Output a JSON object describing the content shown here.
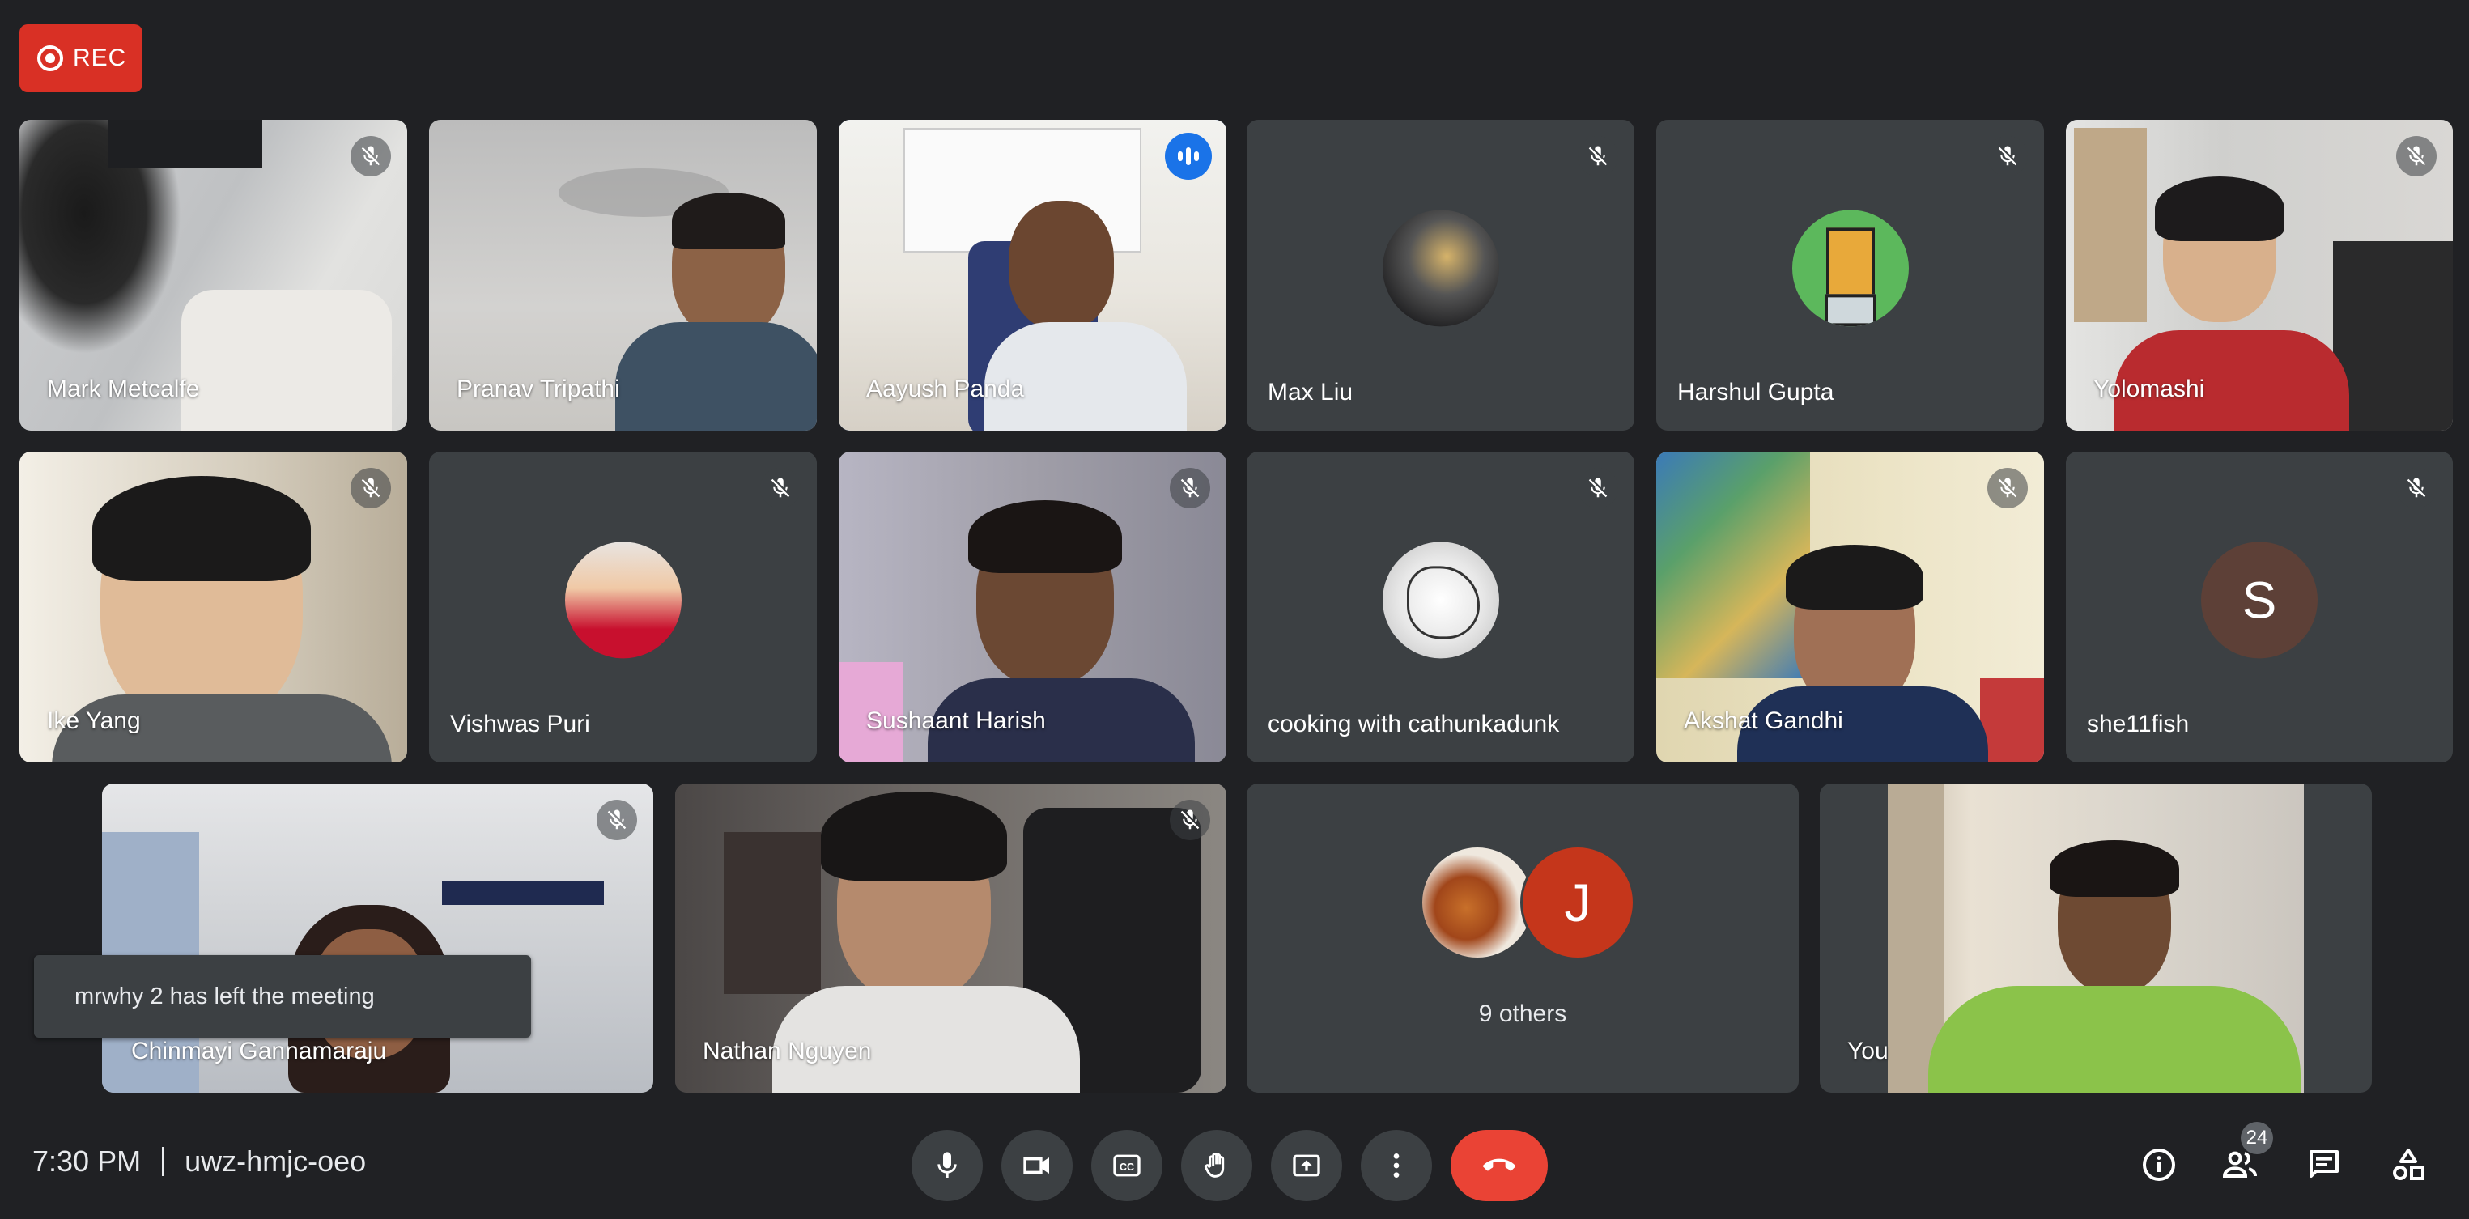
{
  "recording": {
    "label": "REC"
  },
  "participants": [
    {
      "name": "Mark Metcalfe",
      "muted": true
    },
    {
      "name": "Pranav Tripathi",
      "muted": false
    },
    {
      "name": "Aayush Panda",
      "speaking": true
    },
    {
      "name": "Max Liu",
      "muted": true
    },
    {
      "name": "Harshul Gupta",
      "muted": true
    },
    {
      "name": "Yolomashi",
      "muted": true
    },
    {
      "name": "Ike Yang",
      "muted": true
    },
    {
      "name": "Vishwas Puri",
      "muted": true
    },
    {
      "name": "Sushaant Harish",
      "muted": true
    },
    {
      "name": "cooking with cathunkadunk",
      "muted": true
    },
    {
      "name": "Akshat Gandhi",
      "muted": true
    },
    {
      "name": "she11fish",
      "muted": true,
      "avatar_letter": "S",
      "avatar_color": "#5d4037"
    },
    {
      "name": "Chinmayi Gannamaraju",
      "muted": true
    },
    {
      "name": "Nathan Nguyen",
      "muted": true
    },
    {
      "name": "You",
      "muted": false
    }
  ],
  "others_tile": {
    "label": "9 others",
    "avatar_letter": "J",
    "avatar_color": "#c5361b"
  },
  "notification": {
    "text": "mrwhy 2 has left the meeting"
  },
  "bottom_bar": {
    "time": "7:30 PM",
    "meeting_code": "uwz-hmjc-oeo",
    "participant_count": "24",
    "controls": [
      "microphone",
      "camera",
      "captions",
      "raise-hand",
      "present",
      "more-options",
      "leave-call"
    ],
    "right_controls": [
      "meeting-details",
      "people",
      "chat",
      "activities"
    ]
  },
  "colors": {
    "background": "#202124",
    "tile": "#3c4043",
    "accent": "#8ab4f8",
    "end_call": "#ea4335",
    "rec": "#d93025"
  }
}
